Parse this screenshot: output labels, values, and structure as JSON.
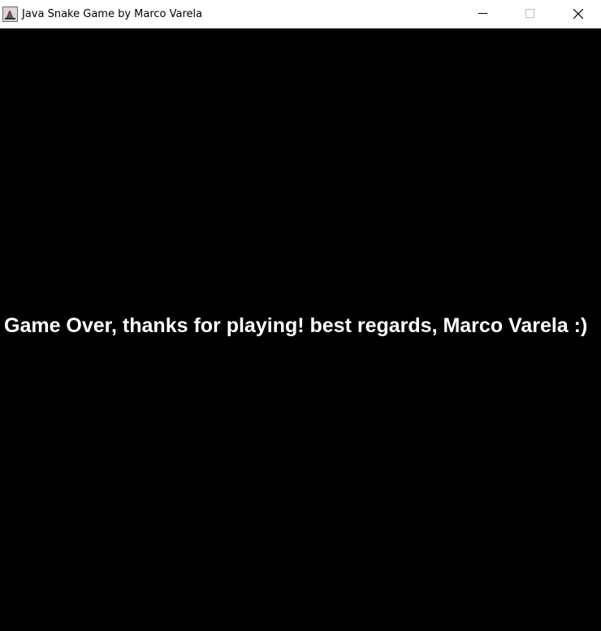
{
  "window": {
    "title": "Java Snake Game by Marco Varela",
    "icon": "java-app-icon",
    "controls": {
      "minimize_icon": "minimize-icon",
      "maximize_icon": "maximize-icon",
      "close_icon": "close-icon"
    },
    "colors": {
      "titlebar_background": "#ffffff",
      "title_text": "#000000",
      "maximize_disabled": "#bfbfbf"
    }
  },
  "game": {
    "message": "Game Over, thanks for playing! best regards, Marco Varela :)",
    "colors": {
      "background": "#000000",
      "message_text": "#ffffff"
    }
  }
}
